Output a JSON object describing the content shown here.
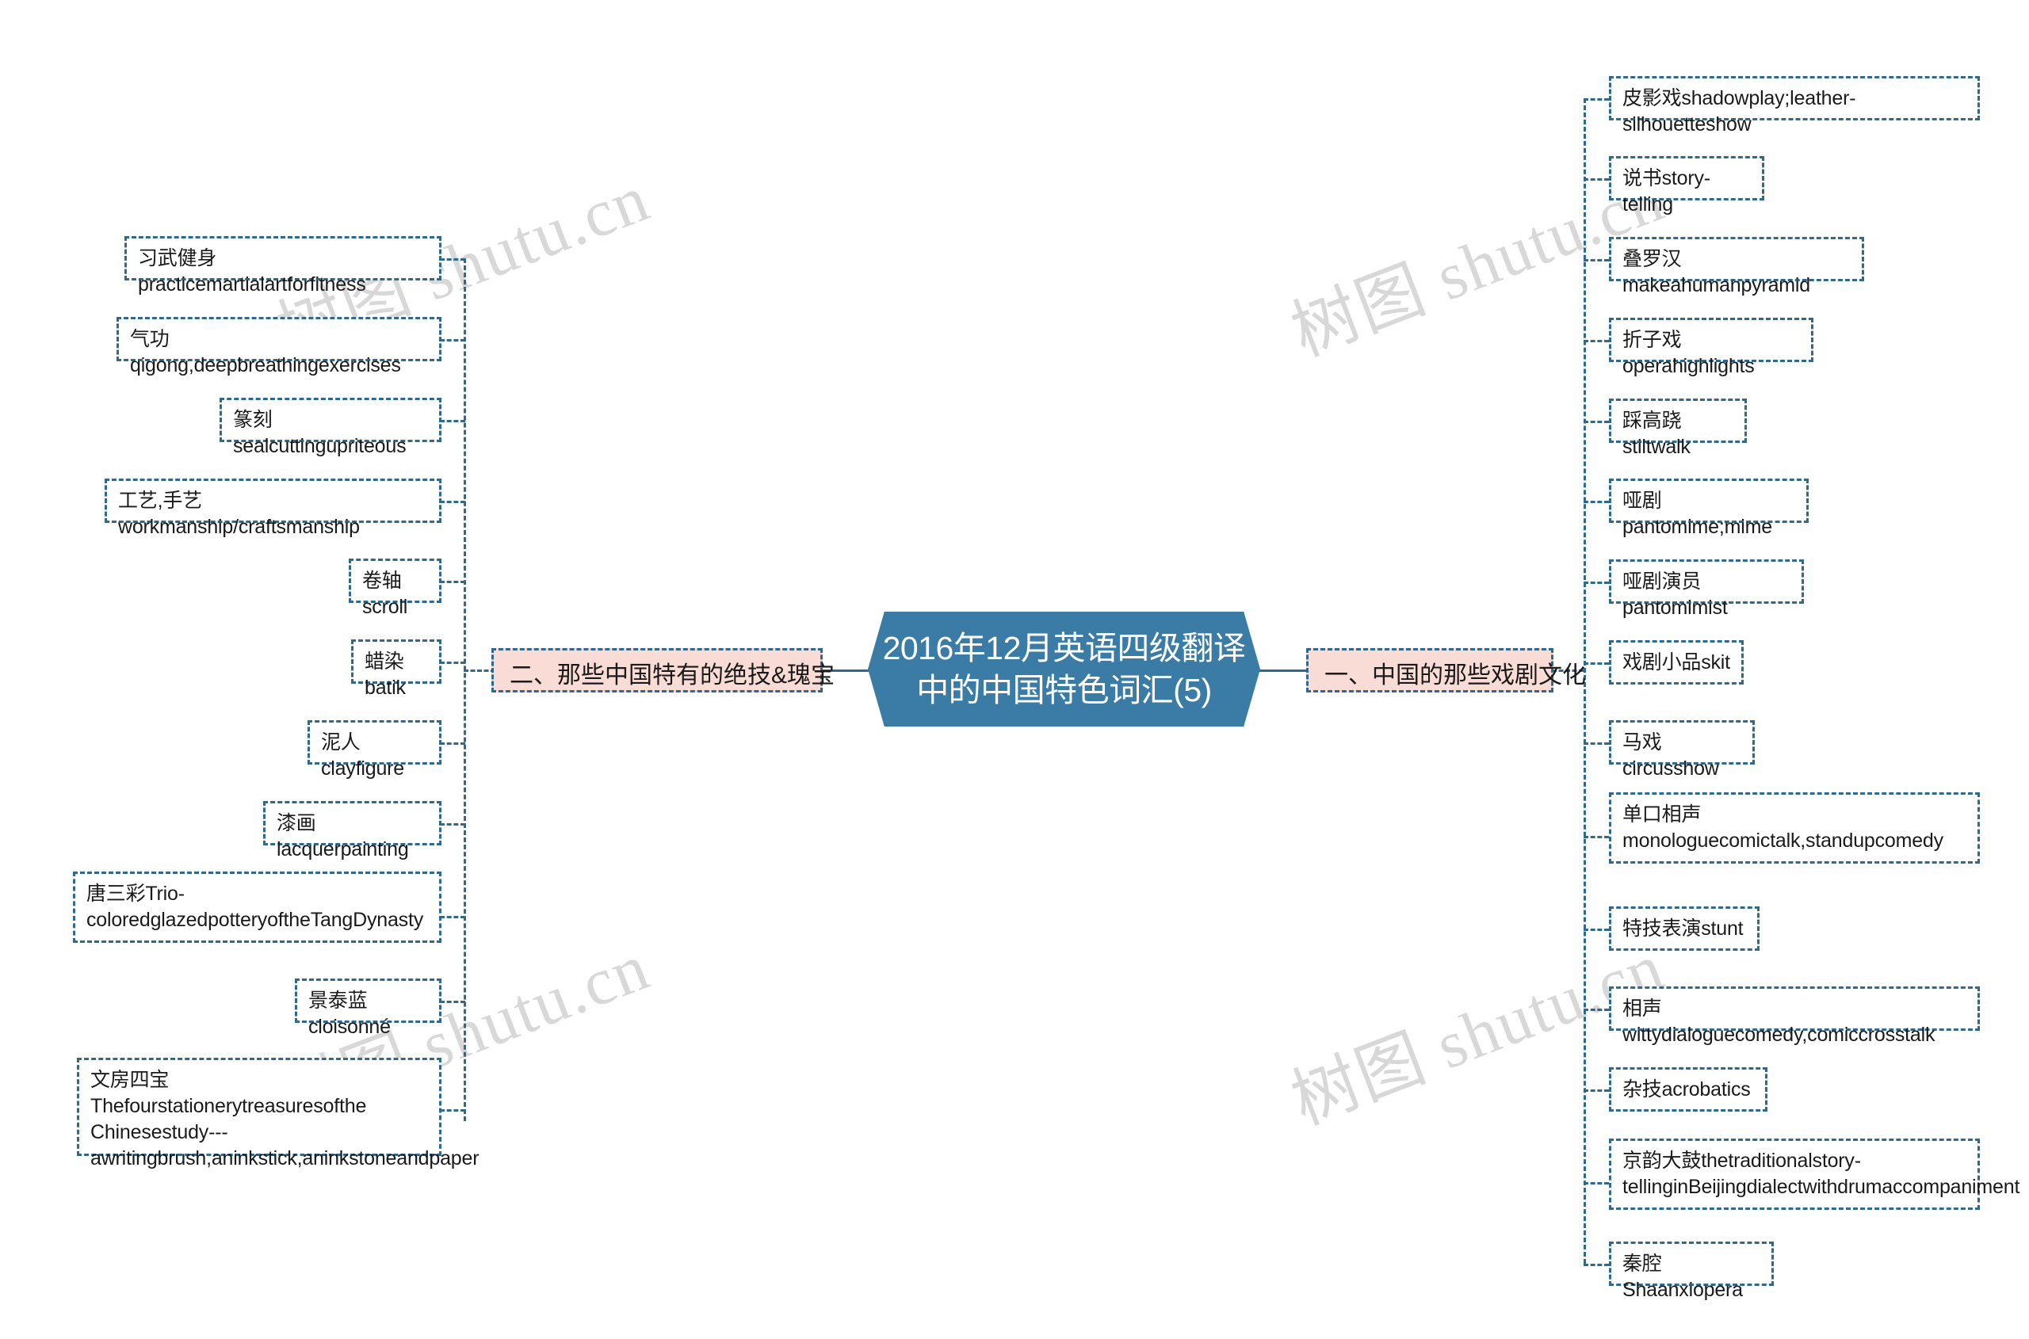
{
  "watermark": {
    "text": "树图 shutu.cn",
    "color": "#d8d8d8"
  },
  "theme": {
    "center_fill": "#3a7ca5",
    "center_text": "#ffffff",
    "branch_fill": "#f9dcd6",
    "border": "#2f6a8c",
    "leaf_fill": "#ffffff",
    "text": "#1a1a1a",
    "background": "#ffffff"
  },
  "mindmap": {
    "root": {
      "label": "2016年12月英语四级翻译\n中的中国特色词汇(5)"
    },
    "branches": [
      {
        "id": "branch-left",
        "side": "left",
        "label": "二、那些中国特有的绝技&瑰宝",
        "children": [
          {
            "label": "习武健身practicemartialartforfitness"
          },
          {
            "label": "气功qigong,deepbreathingexercises"
          },
          {
            "label": "篆刻sealcuttingupriteous"
          },
          {
            "label": "工艺,手艺workmanship/craftsmanship"
          },
          {
            "label": "卷轴scroll"
          },
          {
            "label": "蜡染batik"
          },
          {
            "label": "泥人clayfigure"
          },
          {
            "label": "漆画lacquerpainting"
          },
          {
            "label": "唐三彩Trio-coloredglazedpotteryoftheTangDynasty"
          },
          {
            "label": "景泰蓝cloisonné"
          },
          {
            "label": "文房四宝Thefourstationerytreasuresofthe Chinesestudy---awritingbrush,aninkstick,aninkstoneandpaper"
          }
        ]
      },
      {
        "id": "branch-right",
        "side": "right",
        "label": "一、中国的那些戏剧文化",
        "children": [
          {
            "label": "皮影戏shadowplay;leather-silhouetteshow"
          },
          {
            "label": "说书story-telling"
          },
          {
            "label": "叠罗汉makeahumanpyramid"
          },
          {
            "label": "折子戏operahighlights"
          },
          {
            "label": "踩高跷stiltwalk"
          },
          {
            "label": "哑剧pantomime;mime"
          },
          {
            "label": "哑剧演员pantomimist"
          },
          {
            "label": "戏剧小品skit"
          },
          {
            "label": "马戏circusshow"
          },
          {
            "label": "单口相声monologuecomictalk,standupcomedy"
          },
          {
            "label": "特技表演stunt"
          },
          {
            "label": "相声wittydialoguecomedy,comiccrosstalk"
          },
          {
            "label": "杂技acrobatics"
          },
          {
            "label": "京韵大鼓thetraditionalstory-tellinginBeijingdialectwithdrumaccompaniment"
          },
          {
            "label": "秦腔Shaanxiopera"
          }
        ]
      }
    ]
  }
}
